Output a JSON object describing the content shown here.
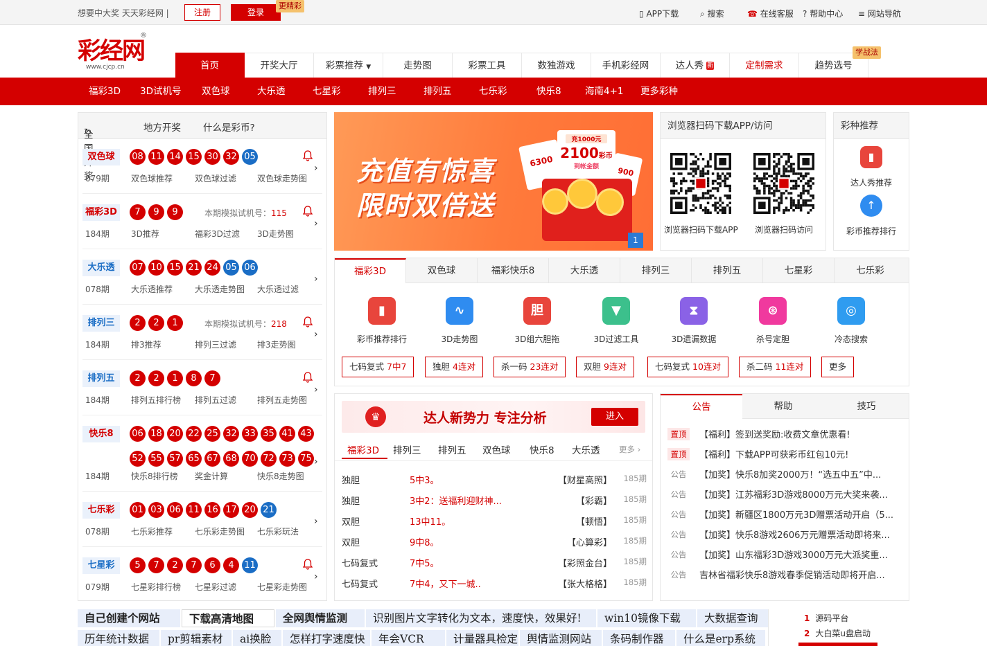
{
  "topbar": {
    "slogan": "想要中大奖 天天彩经网 |",
    "register": "注册",
    "login": "登录",
    "tag": "更精彩",
    "links": [
      {
        "label": "APP下载",
        "icon": "phone-icon"
      },
      {
        "label": "搜索",
        "icon": "search-icon"
      },
      {
        "label": "在线客服",
        "icon": "headset-icon"
      },
      {
        "label": "帮助中心",
        "icon": "help-icon"
      },
      {
        "label": "网站导航",
        "icon": "menu-icon"
      }
    ]
  },
  "logo": {
    "text": "彩经网",
    "url": "www.cjcp.cn",
    "reg": "®"
  },
  "nav": {
    "items": [
      "首页",
      "开奖大厅",
      "彩票推荐",
      "走势图",
      "彩票工具",
      "数独游戏",
      "手机彩经网",
      "达人秀",
      "定制需求",
      "趋势选号"
    ],
    "new_badge": "新",
    "study_tag": "学战法"
  },
  "subnav": [
    "福彩3D",
    "3D试机号",
    "双色球",
    "大乐透",
    "七星彩",
    "排列三",
    "排列五",
    "七乐彩",
    "快乐8",
    "海南4+1",
    "更多彩种"
  ],
  "left": {
    "tabs": [
      "全国开奖",
      "地方开奖",
      "什么是彩币?"
    ],
    "rows": [
      {
        "name": "双色球",
        "red": [
          "08",
          "11",
          "14",
          "15",
          "30",
          "32"
        ],
        "blue": [
          "05"
        ],
        "sim": "",
        "period": "079期",
        "links": [
          "双色球推荐",
          "双色球过滤",
          "双色球走势图"
        ]
      },
      {
        "name": "福彩3D",
        "red": [
          "7",
          "9",
          "9"
        ],
        "blue": [],
        "sim": "本期模拟试机号：",
        "simv": "115",
        "period": "184期",
        "links": [
          "3D推荐",
          "福彩3D过滤",
          "3D走势图"
        ]
      },
      {
        "name": "大乐透",
        "red": [
          "07",
          "10",
          "15",
          "21",
          "24"
        ],
        "blue": [
          "05",
          "06"
        ],
        "sim": "",
        "period": "078期",
        "links": [
          "大乐透推荐",
          "大乐透走势图",
          "大乐透过滤"
        ]
      },
      {
        "name": "排列三",
        "red": [
          "2",
          "2",
          "1"
        ],
        "blue": [],
        "sim": "本期模拟试机号：",
        "simv": "218",
        "period": "184期",
        "links": [
          "排3推荐",
          "排列三过滤",
          "排3走势图"
        ]
      },
      {
        "name": "排列五",
        "red": [
          "2",
          "2",
          "1",
          "8",
          "7"
        ],
        "blue": [],
        "sim": "",
        "period": "184期",
        "links": [
          "排列五排行榜",
          "排列五过滤",
          "排列五走势图"
        ]
      },
      {
        "name": "快乐8",
        "red": [
          "06",
          "18",
          "20",
          "22",
          "25",
          "32",
          "33",
          "35",
          "41",
          "43"
        ],
        "red2": [
          "52",
          "55",
          "57",
          "65",
          "67",
          "68",
          "70",
          "72",
          "73",
          "75"
        ],
        "blue": [],
        "sim": "",
        "period": "184期",
        "links": [
          "快乐8排行榜",
          "奖金计算",
          "快乐8走势图"
        ]
      },
      {
        "name": "七乐彩",
        "red": [
          "01",
          "03",
          "06",
          "11",
          "16",
          "17",
          "20"
        ],
        "blue": [
          "21"
        ],
        "sim": "",
        "period": "078期",
        "links": [
          "七乐彩推荐",
          "七乐彩走势图",
          "七乐彩玩法"
        ]
      },
      {
        "name": "七星彩",
        "red": [
          "5",
          "7",
          "2",
          "7",
          "6",
          "4"
        ],
        "blue": [
          "11"
        ],
        "sim": "",
        "period": "079期",
        "links": [
          "七星彩排行榜",
          "七星彩过滤",
          "七星彩走势图"
        ]
      }
    ]
  },
  "banner": {
    "line1": "充值有惊喜",
    "line2": "限时双倍送",
    "card1": "2100",
    "card1_unit": "彩币",
    "card1_top": "充1000元",
    "card1_sub": "到帐金额",
    "card2": "6300",
    "card3": "900",
    "page": "1"
  },
  "qr": {
    "title": "浏览器扫码下载APP/访问",
    "captions": [
      "浏览器扫码下载APP",
      "浏览器扫码访问"
    ]
  },
  "rec": {
    "title": "彩种推荐",
    "items": [
      "达人秀推荐",
      "彩币推荐排行"
    ]
  },
  "tools": {
    "tabs": [
      "福彩3D",
      "双色球",
      "福彩快乐8",
      "大乐透",
      "排列三",
      "排列五",
      "七星彩",
      "七乐彩"
    ],
    "icons": [
      {
        "label": "彩币推荐排行",
        "color": "#e8453c",
        "glyph": "▮"
      },
      {
        "label": "3D走势图",
        "color": "#2f8cf0",
        "glyph": "∿"
      },
      {
        "label": "3D组六胆拖",
        "color": "#e8453c",
        "glyph": "胆"
      },
      {
        "label": "3D过滤工具",
        "color": "#3cc08c",
        "glyph": "▼"
      },
      {
        "label": "3D遗漏数据",
        "color": "#8a62e6",
        "glyph": "⧗"
      },
      {
        "label": "杀号定胆",
        "color": "#f0399e",
        "glyph": "⊛"
      },
      {
        "label": "冷态搜索",
        "color": "#2f9cf0",
        "glyph": "◎"
      }
    ],
    "chips": [
      {
        "a": "七码复式",
        "b": "7中7"
      },
      {
        "a": "独胆",
        "b": "4连对"
      },
      {
        "a": "杀一码",
        "b": "23连对"
      },
      {
        "a": "双胆",
        "b": "9连对"
      },
      {
        "a": "七码复式",
        "b": "10连对"
      },
      {
        "a": "杀二码",
        "b": "11连对"
      },
      {
        "a": "更多",
        "b": ""
      }
    ]
  },
  "expert": {
    "banner": "达人新势力 专注分析",
    "enter": "进入",
    "tabs": [
      "福彩3D",
      "排列三",
      "排列五",
      "双色球",
      "快乐8",
      "大乐透"
    ],
    "more": "更多",
    "rows": [
      {
        "type": "独胆",
        "result": "5中3。",
        "author": "【财星高照】",
        "period": "185期"
      },
      {
        "type": "独胆",
        "result": "3中2：送福利迎财神...",
        "author": "【彩霸】",
        "period": "185期"
      },
      {
        "type": "双胆",
        "result": "13中11。",
        "author": "【顿悟】",
        "period": "185期"
      },
      {
        "type": "双胆",
        "result": "9中8。",
        "author": "【心算彩】",
        "period": "185期"
      },
      {
        "type": "七码复式",
        "result": "7中5。",
        "author": "【彩照金台】",
        "period": "185期"
      },
      {
        "type": "七码复式",
        "result": "7中4，又下一城..",
        "author": "【张大格格】",
        "period": "185期"
      }
    ]
  },
  "news": {
    "tabs": [
      "公告",
      "帮助",
      "技巧"
    ],
    "rows": [
      {
        "kind": "置顶",
        "top": true,
        "text": "【福利】签到送奖励:收费文章优惠看!"
      },
      {
        "kind": "置顶",
        "top": true,
        "text": "【福利】下载APP可获彩币红包10元!"
      },
      {
        "kind": "公告",
        "top": false,
        "text": "【加奖】快乐8加奖2000万！“选五中五”中..."
      },
      {
        "kind": "公告",
        "top": false,
        "text": "【加奖】江苏福彩3D游戏8000万元大奖来袭..."
      },
      {
        "kind": "公告",
        "top": false,
        "text": "【加奖】新疆区1800万元3D赠票活动开启（5..."
      },
      {
        "kind": "公告",
        "top": false,
        "text": "【加奖】快乐8游戏2606万元赠票活动即将来..."
      },
      {
        "kind": "公告",
        "top": false,
        "text": "【加奖】山东福彩3D游戏3000万元大派奖重..."
      },
      {
        "kind": "公告",
        "top": false,
        "text": "吉林省福彩快乐8游戏春季促销活动即将开启..."
      }
    ]
  },
  "keywords": {
    "row1": [
      "自己创建个网站",
      "下载高清地图",
      "全网舆情监测",
      "识别图片文字转化为文本，速度快，效果好!",
      "win10镜像下载",
      "大数据查询"
    ],
    "row2": [
      "历年统计数据",
      "pr剪辑素材",
      "ai换脸",
      "怎样打字速度快",
      "年会VCR",
      "计量器具检定",
      "舆情监测网站",
      "条码制作器",
      "什么是erp系统"
    ],
    "ranks": [
      {
        "n": "1",
        "t": "源码平台"
      },
      {
        "n": "2",
        "t": "大白菜u盘启动"
      }
    ]
  }
}
